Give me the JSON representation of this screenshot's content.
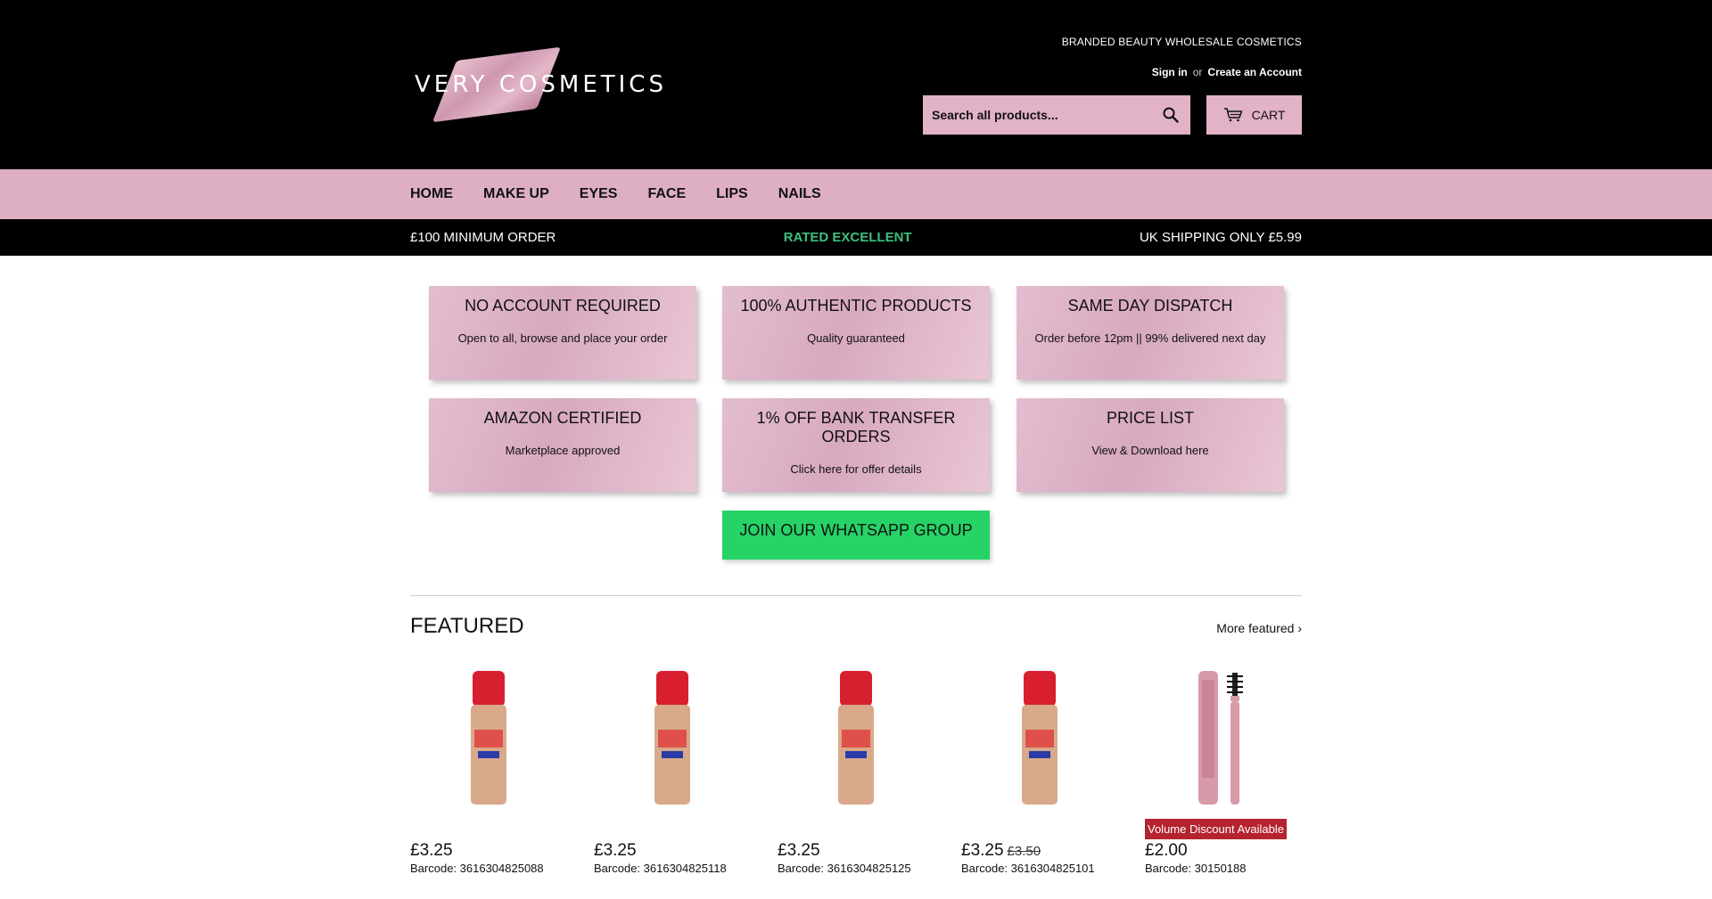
{
  "header": {
    "logo_text": "VERY COSMETICS",
    "tagline": "BRANDED BEAUTY WHOLESALE COSMETICS",
    "sign_in": "Sign in",
    "or": "or",
    "create_account": "Create an Account",
    "search_placeholder": "Search all products...",
    "cart_label": "CART"
  },
  "nav": {
    "items": [
      "HOME",
      "MAKE UP",
      "EYES",
      "FACE",
      "LIPS",
      "NAILS"
    ]
  },
  "announce": {
    "left": "£100 MINIMUM ORDER",
    "center": "RATED EXCELLENT",
    "right": "UK SHIPPING ONLY £5.99"
  },
  "features": [
    {
      "title": "NO ACCOUNT REQUIRED",
      "subtitle": "Open to all, browse and place your order"
    },
    {
      "title": "100% AUTHENTIC PRODUCTS",
      "subtitle": "Quality guaranteed"
    },
    {
      "title": "SAME DAY DISPATCH",
      "subtitle": "Order before 12pm || 99% delivered next day"
    },
    {
      "title": "AMAZON CERTIFIED",
      "subtitle": "Marketplace approved"
    },
    {
      "title": "1% OFF BANK TRANSFER ORDERS",
      "subtitle": "Click here for offer details"
    },
    {
      "title": "PRICE LIST",
      "subtitle": "View & Download here"
    }
  ],
  "whatsapp_label": "JOIN OUR WHATSAPP GROUP",
  "featured": {
    "title": "FEATURED",
    "more_link": "More featured ›",
    "products": [
      {
        "price": "£3.25",
        "old_price": "",
        "barcode": "Barcode: 3616304825088",
        "badge": "",
        "icon": "foundation-bottle"
      },
      {
        "price": "£3.25",
        "old_price": "",
        "barcode": "Barcode: 3616304825118",
        "badge": "",
        "icon": "foundation-bottle"
      },
      {
        "price": "£3.25",
        "old_price": "",
        "barcode": "Barcode: 3616304825125",
        "badge": "",
        "icon": "foundation-bottle"
      },
      {
        "price": "£3.25",
        "old_price": "£3.50",
        "barcode": "Barcode: 3616304825101",
        "badge": "",
        "icon": "foundation-bottle"
      },
      {
        "price": "£2.00",
        "old_price": "",
        "barcode": "Barcode: 30150188",
        "badge": "Volume Discount Available",
        "icon": "mascara"
      }
    ]
  },
  "colors": {
    "header_bg": "#000000",
    "pink": "#deafc4",
    "whatsapp_green": "#25d366",
    "rated_green": "#3dbf7f",
    "badge_red": "#b4232f"
  }
}
